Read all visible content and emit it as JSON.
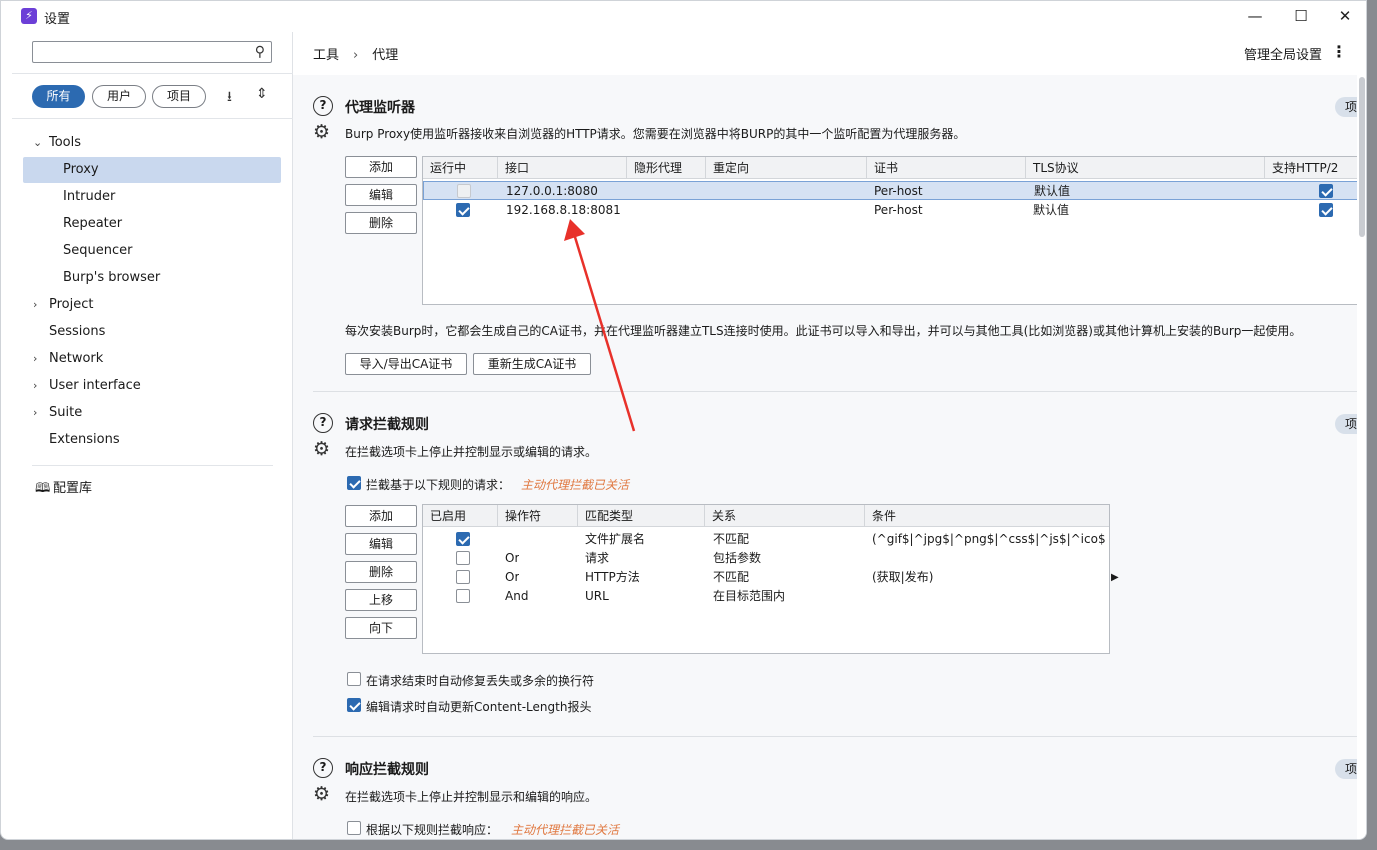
{
  "window": {
    "title": "设置",
    "minimize": "—",
    "maximize": "☐",
    "close": "✕"
  },
  "sidebar": {
    "search_placeholder": "",
    "filters": [
      "所有",
      "用户",
      "项目"
    ],
    "items": [
      {
        "label": "Tools",
        "chevron": "⌄",
        "selected": false
      },
      {
        "label": "Proxy",
        "chevron": "",
        "selected": true
      },
      {
        "label": "Intruder",
        "chevron": "",
        "selected": false
      },
      {
        "label": "Repeater",
        "chevron": "",
        "selected": false
      },
      {
        "label": "Sequencer",
        "chevron": "",
        "selected": false
      },
      {
        "label": "Burp's browser",
        "chevron": "",
        "selected": false
      },
      {
        "label": "Project",
        "chevron": "›",
        "selected": false
      },
      {
        "label": "Sessions",
        "chevron": "",
        "selected": false
      },
      {
        "label": "Network",
        "chevron": "›",
        "selected": false
      },
      {
        "label": "User interface",
        "chevron": "›",
        "selected": false
      },
      {
        "label": "Suite",
        "chevron": "›",
        "selected": false
      },
      {
        "label": "Extensions",
        "chevron": "",
        "selected": false
      }
    ],
    "library": "配置库"
  },
  "breadcrumb": {
    "root": "工具",
    "sep": "›",
    "current": "代理"
  },
  "global_settings": "管理全局设置",
  "proxy_listeners": {
    "title": "代理监听器",
    "desc": "Burp Proxy使用监听器接收来自浏览器的HTTP请求。您需要在浏览器中将BURP的其中一个监听配置为代理服务器。",
    "badge": "项",
    "buttons": [
      "添加",
      "编辑",
      "删除"
    ],
    "columns": [
      "运行中",
      "接口",
      "隐形代理",
      "重定向",
      "证书",
      "TLS协议",
      "支持HTTP/2"
    ],
    "rows": [
      {
        "running": false,
        "interface": "127.0.0.1:8080",
        "invisible": "",
        "redirect": "",
        "cert": "Per-host",
        "tls": "默认值",
        "http2": true,
        "selected": true
      },
      {
        "running": true,
        "interface": "192.168.8.18:8081",
        "invisible": "",
        "redirect": "",
        "cert": "Per-host",
        "tls": "默认值",
        "http2": true,
        "selected": false
      }
    ],
    "ca_note": "每次安装Burp时，它都会生成自己的CA证书，并在代理监听器建立TLS连接时使用。此证书可以导入和导出，并可以与其他工具(比如浏览器)或其他计算机上安装的Burp一起使用。",
    "ca_buttons": [
      "导入/导出CA证书",
      "重新生成CA证书"
    ]
  },
  "request_rules": {
    "title": "请求拦截规则",
    "desc": "在拦截选项卡上停止并控制显示或编辑的请求。",
    "badge": "项",
    "intercept_label": "拦截基于以下规则的请求：",
    "intercept_checked": true,
    "intercept_note": "主动代理拦截已关活",
    "buttons": [
      "添加",
      "编辑",
      "删除",
      "上移",
      "向下"
    ],
    "columns": [
      "已启用",
      "操作符",
      "匹配类型",
      "关系",
      "条件"
    ],
    "rows": [
      {
        "enabled": true,
        "op": "",
        "type": "文件扩展名",
        "rel": "不匹配",
        "cond": "(^gif$|^jpg$|^png$|^css$|^js$|^ico$|..."
      },
      {
        "enabled": false,
        "op": "Or",
        "type": "请求",
        "rel": "包括参数",
        "cond": ""
      },
      {
        "enabled": false,
        "op": "Or",
        "type": "HTTP方法",
        "rel": "不匹配",
        "cond": "(获取|发布)"
      },
      {
        "enabled": false,
        "op": "And",
        "type": "URL",
        "rel": "在目标范围内",
        "cond": ""
      }
    ],
    "opt1": {
      "label": "在请求结束时自动修复丢失或多余的换行符",
      "checked": false
    },
    "opt2": {
      "label": "编辑请求时自动更新Content-Length报头",
      "checked": true
    }
  },
  "response_rules": {
    "title": "响应拦截规则",
    "desc": "在拦截选项卡上停止并控制显示和编辑的响应。",
    "badge": "项",
    "intercept_label": "根据以下规则拦截响应：",
    "intercept_note": "主动代理拦截已关活"
  },
  "colors": {
    "accent": "#2c6ab1",
    "selection": "#c9d8ee",
    "arrow": "#e8312a"
  }
}
